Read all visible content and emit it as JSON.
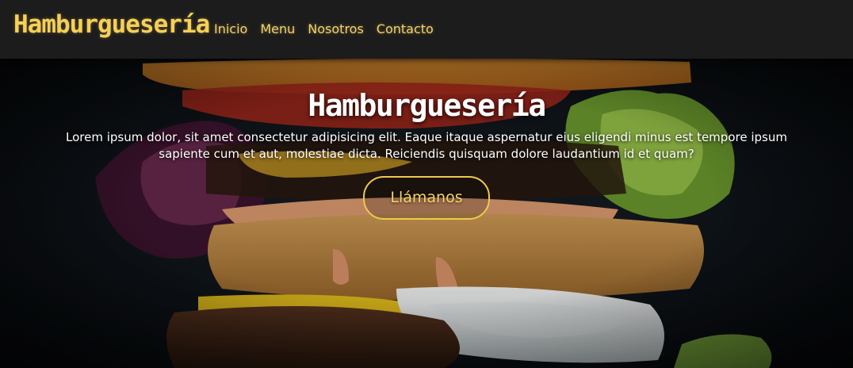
{
  "navbar": {
    "brand": "Hamburguesería",
    "links": [
      "Inicio",
      "Menu",
      "Nosotros",
      "Contacto"
    ]
  },
  "hero": {
    "title": "Hamburguesería",
    "text": "Lorem ipsum dolor, sit amet consectetur adipisicing elit. Eaque itaque aspernatur eius eligendi minus est tempore ipsum sapiente cum et aut, molestiae dicta. Reiciendis quisquam dolore laudantium id et quam?",
    "button": "Llámanos",
    "background_image": "burger-photo"
  },
  "colors": {
    "accent": "#f6cf58",
    "navbar_bg": "#1c1c1c",
    "hero_text": "#ffffff"
  }
}
